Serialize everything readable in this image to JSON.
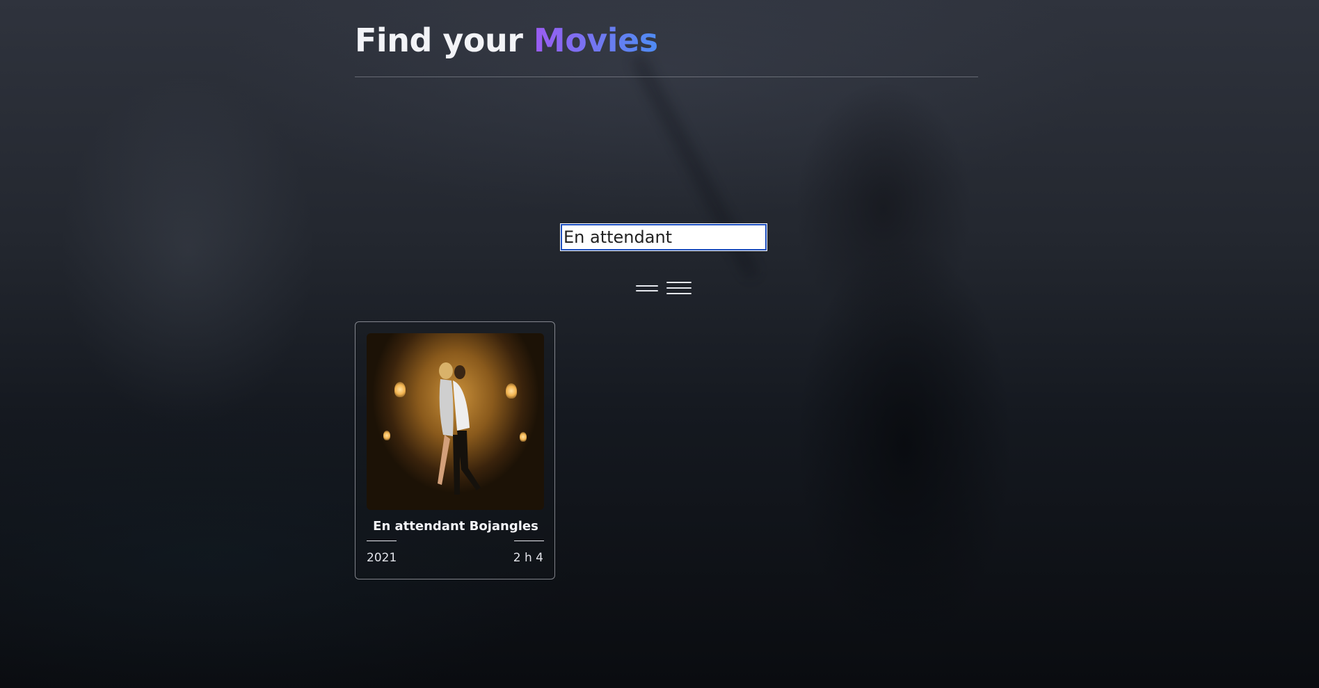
{
  "header": {
    "title_prefix": "Find your",
    "title_accent": "Movies"
  },
  "search": {
    "value": "En attendant",
    "placeholder": ""
  },
  "view_toggles": [
    {
      "name": "compact-view",
      "icon": "double-line-icon"
    },
    {
      "name": "list-view",
      "icon": "menu-lines-icon"
    }
  ],
  "results": [
    {
      "title": "En attendant Bojangles",
      "year": "2021",
      "duration": "2 h 4"
    }
  ],
  "colors": {
    "accent_start": "#9b5cf2",
    "accent_end": "#4f8cf4",
    "search_border": "#1d4fbf"
  }
}
